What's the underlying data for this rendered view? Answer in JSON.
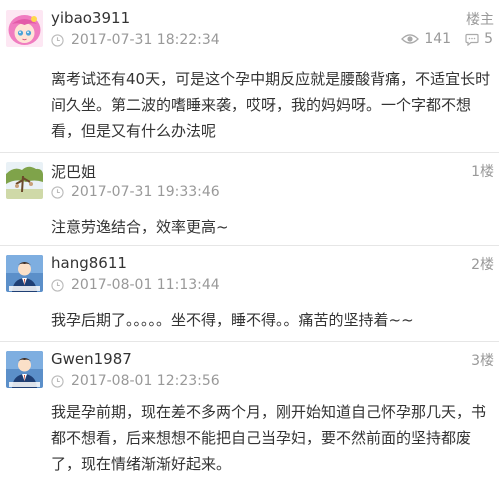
{
  "posts": [
    {
      "username": "yibao3911",
      "time": "2017-07-31 18:22:34",
      "floor": "楼主",
      "views": "141",
      "replies": "5",
      "content": "离考试还有40天，可是这个孕中期反应就是腰酸背痛，不适宜长时间久坐。第二波的嗜睡来袭，哎呀，我的妈妈呀。一个字都不想看，但是又有什么办法呢",
      "avatar": "anime-girl-pink-hair-icon"
    },
    {
      "username": "泥巴姐",
      "time": "2017-07-31 19:33:46",
      "floor": "1楼",
      "content": "注意劳逸结合，效率更高~",
      "avatar": "tree-landscape-icon"
    },
    {
      "username": "hang8611",
      "time": "2017-08-01 11:13:44",
      "floor": "2楼",
      "content": "我孕后期了。。。。。坐不得，睡不得。。痛苦的坚持着~~",
      "avatar": "default-user-icon"
    },
    {
      "username": "Gwen1987",
      "time": "2017-08-01 12:23:56",
      "floor": "3楼",
      "content": "我是孕前期，现在差不多两个月，刚开始知道自己怀孕那几天，书都不想看，后来想想不能把自己当孕妇，要不然前面的坚持都废了，现在情绪渐渐好起来。",
      "avatar": "default-user-icon"
    }
  ],
  "colors": {
    "text": "#333333",
    "muted": "#999999",
    "divider": "#e6e6e6"
  }
}
